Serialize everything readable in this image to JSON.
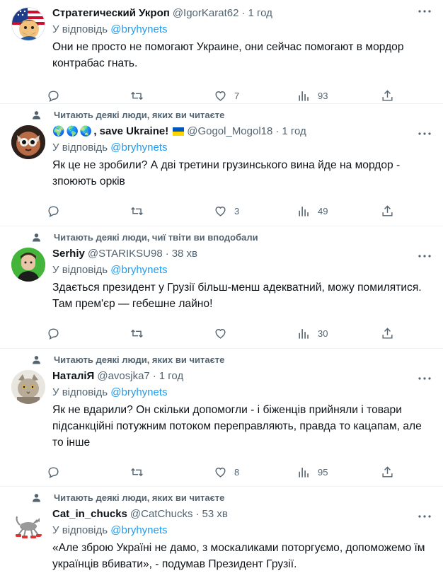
{
  "tweets": [
    {
      "social": "",
      "name": "Стратегический Укроп",
      "handle": "@IgorKarat62",
      "time": "1 год",
      "reply_prefix": "У відповідь",
      "reply_to": "@bryhynets",
      "text": "Они не просто не помогают Украине, они сейчас помогают в мордор контрабас гнать.",
      "likes": "7",
      "views": "93"
    },
    {
      "social": "Читають деякі люди, яких ви читаєте",
      "name": ", save Ukraine!",
      "handle": "@Gogol_Mogol18",
      "time": "1 год",
      "reply_prefix": "У відповідь",
      "reply_to": "@bryhynets",
      "text": "Як це не зробили? А дві третини грузинського вина йде на мордор - зпоюють орків",
      "likes": "3",
      "views": "49"
    },
    {
      "social": "Читають деякі люди, чиї твіти ви вподобали",
      "name": "Serhiy",
      "handle": "@STARIKSU98",
      "time": "38 хв",
      "reply_prefix": "У відповідь",
      "reply_to": "@bryhynets",
      "text": "Здається президент у Грузії більш-менш адекватний, можу помилятися. Там прем'єр — гебешне лайно!",
      "likes": "",
      "views": "30"
    },
    {
      "social": "Читають деякі люди, яких ви читаєте",
      "name": "НаталіЯ",
      "handle": "@avosjka7",
      "time": "1 год",
      "reply_prefix": "У відповідь",
      "reply_to": "@bryhynets",
      "text": "Як не вдарили? Он скільки допомогли - і біженців прийняли і товари підсанкційні потужним потоком переправляють, правда то кацапам, але то інше",
      "likes": "8",
      "views": "95"
    },
    {
      "social": "Читають деякі люди, яких ви читаєте",
      "name": "Cat_in_chucks",
      "handle": "@CatChucks",
      "time": "53 хв",
      "reply_prefix": "У відповідь",
      "reply_to": "@bryhynets",
      "text": "«Але зброю Україні не дамо, з москаликами поторгуємо, допоможемо їм українців вбивати», - подумав Президент Грузії.",
      "likes": "",
      "views": ""
    }
  ],
  "dot": "·",
  "colors": {
    "text": "#0f1419",
    "muted": "#536471",
    "link": "#1d9bf0",
    "divider": "#eff3f4"
  }
}
